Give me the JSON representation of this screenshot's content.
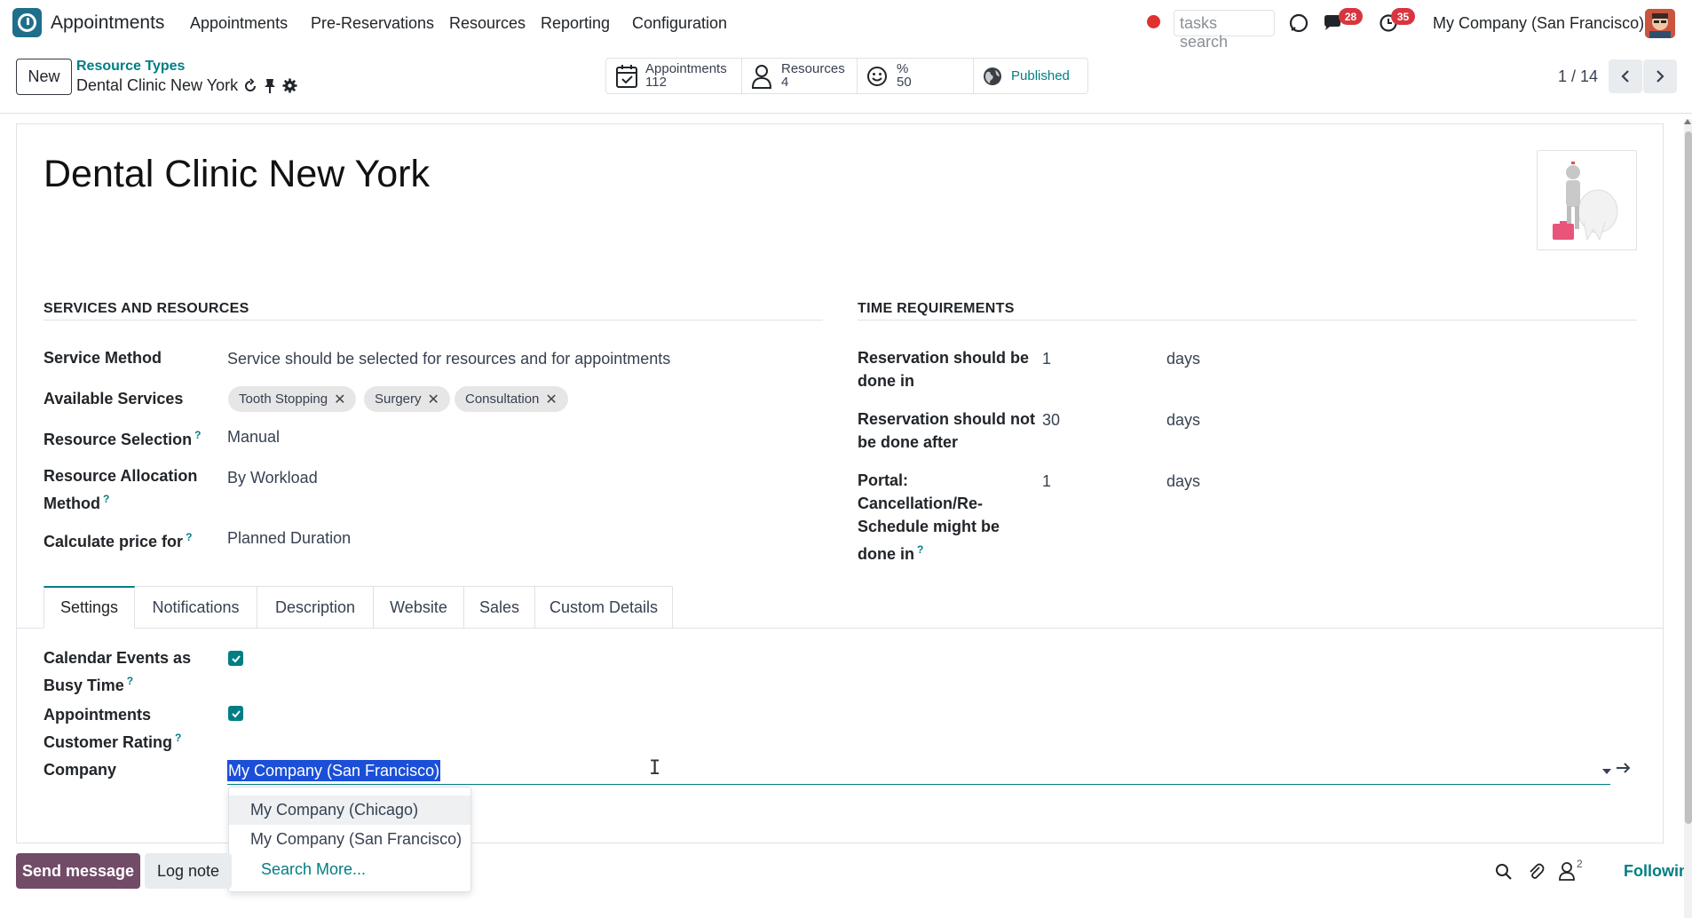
{
  "topnav": {
    "app_name": "Appointments",
    "menu": [
      "Appointments",
      "Pre-Reservations",
      "Resources",
      "Reporting",
      "Configuration"
    ],
    "search_placeholder": "tasks search",
    "messages_badge": "28",
    "activities_badge": "35",
    "company": "My Company (San Francisco)"
  },
  "control": {
    "new_label": "New",
    "breadcrumb_parent": "Resource Types",
    "breadcrumb_current": "Dental Clinic New York",
    "stats": {
      "appointments_label": "Appointments",
      "appointments_value": "112",
      "resources_label": "Resources",
      "resources_value": "4",
      "rating_label": "%",
      "rating_value": "50",
      "published_label": "Published"
    },
    "pager": "1 / 14"
  },
  "form": {
    "title": "Dental Clinic New York",
    "services_section": "SERVICES AND RESOURCES",
    "time_section": "TIME REQUIREMENTS",
    "service_method_label": "Service Method",
    "service_method_value": "Service should be selected for resources and for appointments",
    "available_services_label": "Available Services",
    "tags": [
      "Tooth Stopping",
      "Surgery",
      "Consultation"
    ],
    "resource_selection_label": "Resource Selection",
    "resource_selection_value": "Manual",
    "resource_allocation_label_1": "Resource Allocation",
    "resource_allocation_label_2": "Method",
    "resource_allocation_value": "By Workload",
    "calculate_price_label": "Calculate price for",
    "calculate_price_value": "Planned Duration",
    "res_done_in_label_1": "Reservation should be",
    "res_done_in_label_2": "done in",
    "res_done_in_value": "1",
    "res_done_in_unit": "days",
    "res_not_after_label_1": "Reservation should not",
    "res_not_after_label_2": "be done after",
    "res_not_after_value": "30",
    "res_not_after_unit": "days",
    "portal_label_1": "Portal:",
    "portal_label_2": "Cancellation/Re-",
    "portal_label_3": "Schedule might be",
    "portal_label_4": "done in",
    "portal_value": "1",
    "portal_unit": "days",
    "help_mark": "?"
  },
  "tabs": [
    "Settings",
    "Notifications",
    "Description",
    "Website",
    "Sales",
    "Custom Details"
  ],
  "settings": {
    "calendar_busy_label_1": "Calendar Events as",
    "calendar_busy_label_2": "Busy Time",
    "calendar_busy_checked": true,
    "rating_label_1": "Appointments",
    "rating_label_2": "Customer Rating",
    "rating_checked": true,
    "company_label": "Company",
    "company_value": "My Company (San Francisco)"
  },
  "dropdown": {
    "options": [
      "My Company (Chicago)",
      "My Company (San Francisco)"
    ],
    "search_more": "Search More..."
  },
  "chatter": {
    "send_message": "Send message",
    "log_note": "Log note",
    "follower_count": "2",
    "following": "Following"
  },
  "colors": {
    "accent": "#017e84",
    "brand": "#714b67",
    "badge": "#d9353f",
    "selection": "#1b4fd8"
  }
}
